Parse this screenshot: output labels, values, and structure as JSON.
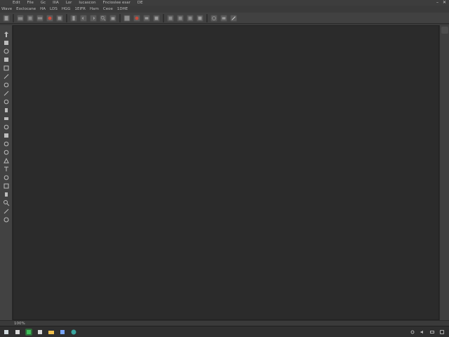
{
  "menubar": {
    "items": [
      "Edit",
      "File",
      "Gc",
      "IIIA",
      "Lor",
      "lucascon",
      "Fncioslee esar",
      "DE"
    ]
  },
  "subbar": {
    "items": [
      "Wave",
      "Eoclocane",
      "HA",
      "LDS",
      "HGG",
      "1ElFR",
      "Ham",
      "Ceoe",
      "1DHE"
    ]
  },
  "window": {
    "minimize": "–",
    "close": "✕"
  },
  "statusbar": {
    "zoom": "100%"
  },
  "icons": {
    "toolbar": [
      "new-file-icon",
      "open-icon",
      "save-icon",
      "print-icon",
      "cut-icon",
      "copy-icon",
      "paste-icon",
      "undo-icon",
      "redo-icon",
      "zoom-icon",
      "hand-icon",
      "layer-icon",
      "brush-icon",
      "eraser-icon",
      "fill-icon",
      "text-icon",
      "shape-icon",
      "crop-icon",
      "select-icon",
      "transform-icon",
      "rotate-icon",
      "flip-icon",
      "eyedropper-icon"
    ],
    "tools": [
      "move-tool-icon",
      "select-tool-icon",
      "lasso-tool-icon",
      "magic-wand-icon",
      "crop-tool-icon",
      "slice-tool-icon",
      "brush-tool-icon",
      "pencil-tool-icon",
      "clone-tool-icon",
      "healing-tool-icon",
      "eraser-tool-icon",
      "fill-tool-icon",
      "gradient-tool-icon",
      "blur-tool-icon",
      "dodge-tool-icon",
      "pen-tool-icon",
      "text-tool-icon",
      "path-tool-icon",
      "shape-tool-icon",
      "hand-tool-icon",
      "zoom-tool-icon",
      "eyedropper-tool-icon",
      "color-swap-icon"
    ],
    "taskbar": [
      "start-icon",
      "file-explorer-icon",
      "app-green-icon",
      "app-window-icon",
      "folder-icon",
      "app-blue-icon",
      "browser-icon"
    ],
    "tray": [
      "network-icon",
      "sound-icon",
      "battery-icon",
      "notification-icon"
    ]
  },
  "colors": {
    "workspace": "#2b2b2b",
    "panel": "#424242",
    "accent_red": "#d44c3c",
    "taskbar": "#2f2f2f"
  }
}
